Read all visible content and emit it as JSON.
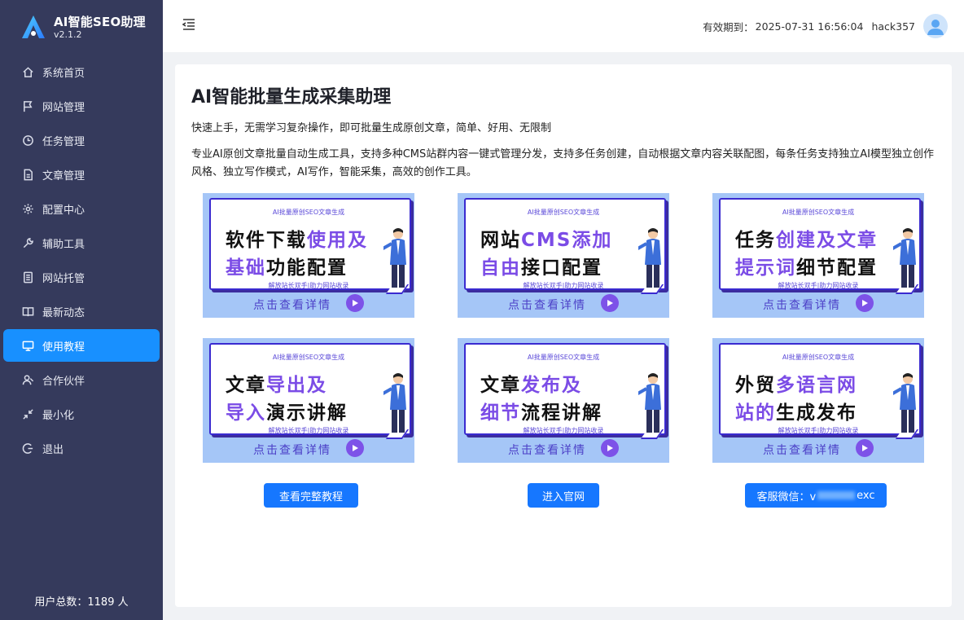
{
  "app": {
    "name": "AI智能SEO助理",
    "version": "v2.1.2"
  },
  "sidebar": {
    "items": [
      {
        "label": "系统首页",
        "icon": "home-icon"
      },
      {
        "label": "网站管理",
        "icon": "flag-icon"
      },
      {
        "label": "任务管理",
        "icon": "clock-icon"
      },
      {
        "label": "文章管理",
        "icon": "document-icon"
      },
      {
        "label": "配置中心",
        "icon": "gear-icon"
      },
      {
        "label": "辅助工具",
        "icon": "wrench-icon"
      },
      {
        "label": "网站托管",
        "icon": "server-icon"
      },
      {
        "label": "最新动态",
        "icon": "book-icon"
      },
      {
        "label": "使用教程",
        "icon": "monitor-icon",
        "active": true
      },
      {
        "label": "合作伙伴",
        "icon": "partner-icon"
      },
      {
        "label": "最小化",
        "icon": "minimize-icon"
      },
      {
        "label": "退出",
        "icon": "logout-icon"
      }
    ],
    "user_count": "用户总数：1189 人"
  },
  "header": {
    "expire_label": "有效期到：",
    "expire_time": "2025-07-31 16:56:04",
    "username": "hack357"
  },
  "main": {
    "title": "AI智能批量生成采集助理",
    "subtitle": "快速上手，无需学习复杂操作，即可批量生成原创文章，简单、好用、无限制",
    "description": "专业AI原创文章批量自动生成工具，支持多种CMS站群内容一键式管理分发，支持多任务创建，自动根据文章内容关联配图，每条任务支持独立AI模型独立创作风格、独立写作模式，AI写作，智能采集，高效的创作工具。",
    "tutorials": [
      {
        "tag": "AI批量原创SEO文章生成",
        "line1_a": "软件下载",
        "line1_b": "使用及",
        "line2_a": "基础",
        "line2_b": "功能配置",
        "slogan": "解放站长双手|助力网站收录",
        "cta": "点击查看详情"
      },
      {
        "tag": "AI批量原创SEO文章生成",
        "line1_a": "网站",
        "line1_b": "CMS添加",
        "line2_a": "自由",
        "line2_b": "接口配置",
        "slogan": "解放站长双手|助力网站收录",
        "cta": "点击查看详情"
      },
      {
        "tag": "AI批量原创SEO文章生成",
        "line1_a": "任务",
        "line1_b": "创建及文章",
        "line2_a": "提示词",
        "line2_b": "细节配置",
        "slogan": "解放站长双手|助力网站收录",
        "cta": "点击查看详情"
      },
      {
        "tag": "AI批量原创SEO文章生成",
        "line1_a": "文章",
        "line1_b": "导出及",
        "line2_a": "导入",
        "line2_b": "演示讲解",
        "slogan": "解放站长双手|助力网站收录",
        "cta": "点击查看详情"
      },
      {
        "tag": "AI批量原创SEO文章生成",
        "line1_a": "文章",
        "line1_b": "发布及",
        "line2_a": "细节",
        "line2_b": "流程讲解",
        "slogan": "解放站长双手|助力网站收录",
        "cta": "点击查看详情"
      },
      {
        "tag": "AI批量原创SEO文章生成",
        "line1_a": "外贸",
        "line1_b": "多语言网",
        "line2_a": "站的",
        "line2_b": "生成发布",
        "slogan": "解放站长双手|助力网站收录",
        "cta": "点击查看详情"
      }
    ],
    "buttons": {
      "full_tutorial": "查看完整教程",
      "official_site": "进入官网",
      "wechat_prefix": "客服微信：v",
      "wechat_suffix": "exc"
    }
  },
  "colors": {
    "sidebar_bg": "#353a5c",
    "accent": "#1890ff",
    "highlight": "#7b4ce6"
  }
}
